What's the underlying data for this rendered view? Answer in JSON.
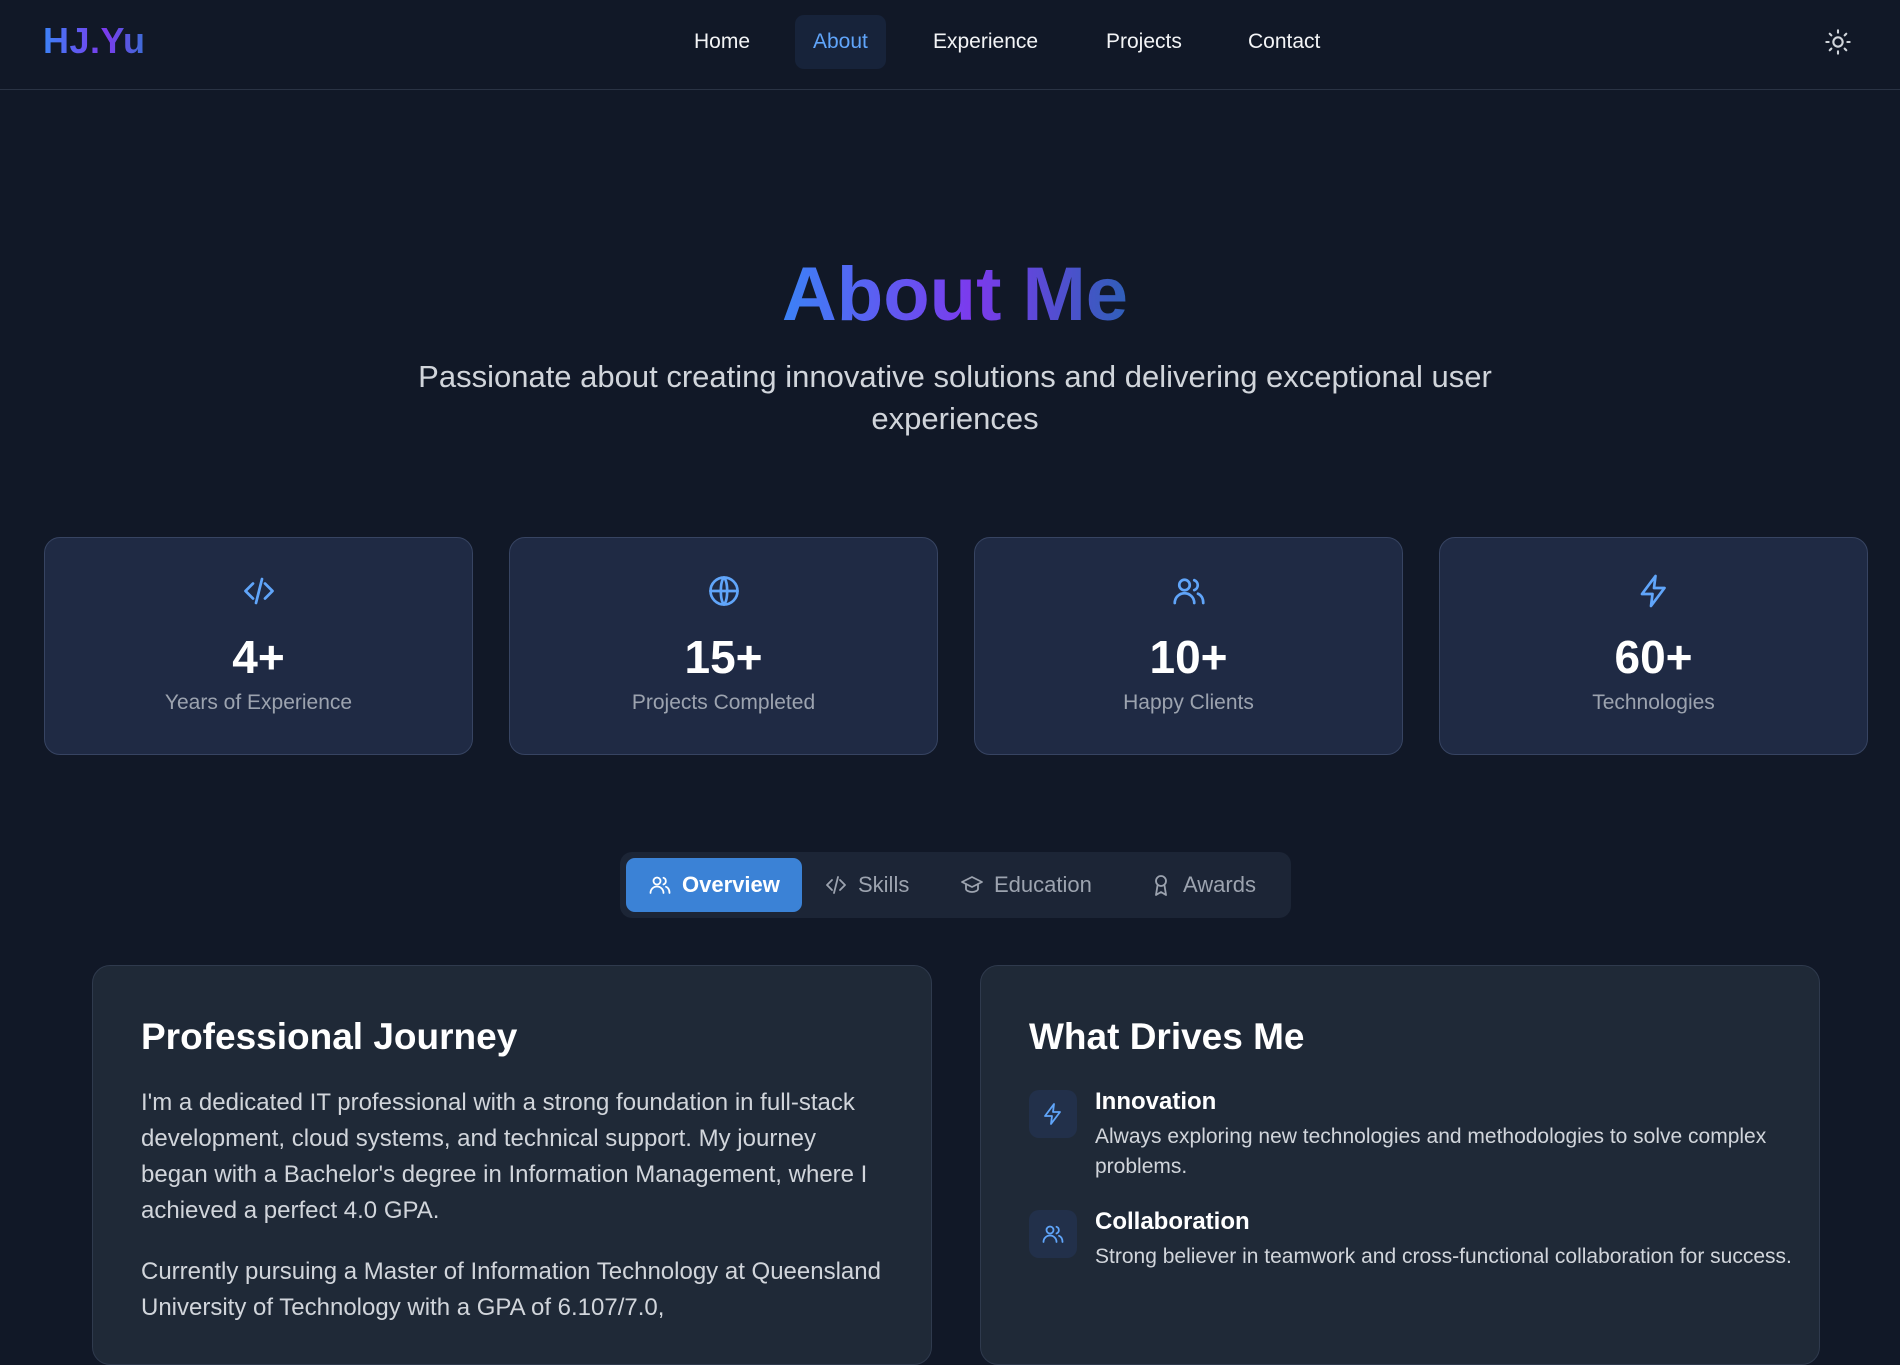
{
  "brand": {
    "logo": "HJ.Yu"
  },
  "nav": {
    "items": [
      {
        "label": "Home"
      },
      {
        "label": "About",
        "active": true
      },
      {
        "label": "Experience"
      },
      {
        "label": "Projects"
      },
      {
        "label": "Contact"
      }
    ],
    "theme_icon": "sun-icon"
  },
  "hero": {
    "title": "About Me",
    "subtitle": "Passionate about creating innovative solutions and delivering exceptional user experiences"
  },
  "stats": [
    {
      "icon": "code-icon",
      "value": "4+",
      "label": "Years of Experience"
    },
    {
      "icon": "globe-icon",
      "value": "15+",
      "label": "Projects Completed"
    },
    {
      "icon": "users-icon",
      "value": "10+",
      "label": "Happy Clients"
    },
    {
      "icon": "zap-icon",
      "value": "60+",
      "label": "Technologies"
    }
  ],
  "tabs": [
    {
      "label": "Overview",
      "icon": "users-icon",
      "active": true
    },
    {
      "label": "Skills",
      "icon": "code-icon"
    },
    {
      "label": "Education",
      "icon": "graduation-cap-icon"
    },
    {
      "label": "Awards",
      "icon": "award-icon"
    }
  ],
  "journey": {
    "title": "Professional Journey",
    "paragraphs": [
      "I'm a dedicated IT professional with a strong foundation in full-stack development, cloud systems, and technical support. My journey began with a Bachelor's degree in Information Management, where I achieved a perfect 4.0 GPA.",
      "Currently pursuing a Master of Information Technology at Queensland University of Technology with a GPA of 6.107/7.0,"
    ]
  },
  "drives": {
    "title": "What Drives Me",
    "items": [
      {
        "icon": "zap-icon",
        "title": "Innovation",
        "desc": "Always exploring new technologies and methodologies to solve complex problems."
      },
      {
        "icon": "users-icon",
        "title": "Collaboration",
        "desc": "Strong believer in teamwork and cross-functional collaboration for success."
      }
    ]
  },
  "colors": {
    "background": "#111827",
    "accent": "#60a5fa",
    "active_tab": "#3b82d6",
    "card": "#1f2a44",
    "panel": "#1f2937"
  }
}
